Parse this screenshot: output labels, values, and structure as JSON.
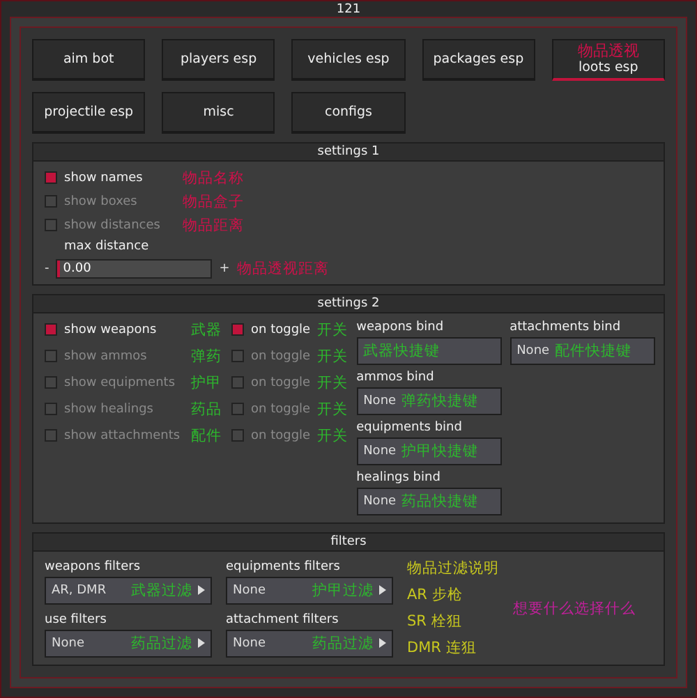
{
  "window": {
    "title": "121"
  },
  "tabs": [
    {
      "label": "aim bot",
      "selected": false
    },
    {
      "label": "players esp",
      "selected": false
    },
    {
      "label": "vehicles esp",
      "selected": false
    },
    {
      "label": "packages esp",
      "selected": false
    },
    {
      "label": "loots esp",
      "selected": true,
      "note": "物品透视"
    },
    {
      "label": "projectile esp",
      "selected": false
    },
    {
      "label": "misc",
      "selected": false
    },
    {
      "label": "configs",
      "selected": false
    }
  ],
  "settings_1": {
    "title": "settings 1",
    "options": [
      {
        "label": "show names",
        "checked": true,
        "note": "物品名称"
      },
      {
        "label": "show boxes",
        "checked": false,
        "note": "物品盒子"
      },
      {
        "label": "show distances",
        "checked": false,
        "note": "物品距离"
      }
    ],
    "slider": {
      "label": "max distance",
      "decrease": "-",
      "increase": "+",
      "value": "0.00",
      "level": 0,
      "note": "物品透视距离"
    }
  },
  "settings_2": {
    "title": "settings 2",
    "items": [
      {
        "label": "show weapons",
        "checked": true,
        "note": "武器",
        "toggle_label": "on toggle",
        "toggle_checked": true,
        "toggle_note": "开关"
      },
      {
        "label": "show ammos",
        "checked": false,
        "note": "弹药",
        "toggle_label": "on toggle",
        "toggle_checked": false,
        "toggle_note": "开关"
      },
      {
        "label": "show equipments",
        "checked": false,
        "note": "护甲",
        "toggle_label": "on toggle",
        "toggle_checked": false,
        "toggle_note": "开关"
      },
      {
        "label": "show healings",
        "checked": false,
        "note": "药品",
        "toggle_label": "on toggle",
        "toggle_checked": false,
        "toggle_note": "开关"
      },
      {
        "label": "show attachments",
        "checked": false,
        "note": "配件",
        "toggle_label": "on toggle",
        "toggle_checked": false,
        "toggle_note": "开关"
      }
    ],
    "binds": [
      {
        "label": "weapons bind",
        "note": "武器快捷键"
      },
      {
        "label": "ammos bind",
        "value": "None",
        "note": "弹药快捷键"
      },
      {
        "label": "equipments bind",
        "value": "None",
        "note": "护甲快捷键"
      },
      {
        "label": "healings bind",
        "value": "None",
        "note": "药品快捷键"
      },
      {
        "label": "attachments bind",
        "value": "None",
        "note": "配件快捷键"
      }
    ]
  },
  "filters": {
    "title": "filters",
    "selects": [
      {
        "label": "weapons filters",
        "value": "AR, DMR",
        "note": "武器过滤"
      },
      {
        "label": "equipments filters",
        "value": "None",
        "note": "护甲过滤"
      },
      {
        "label": "use filters",
        "value": "None",
        "note": "药品过滤"
      },
      {
        "label": "attachment filters",
        "value": "None",
        "note": "药品过滤"
      }
    ],
    "notes": [
      "物品过滤说明",
      "AR 步枪",
      "SR 栓狙",
      "DMR 连狙"
    ],
    "hint": "想要什么选择什么"
  }
}
